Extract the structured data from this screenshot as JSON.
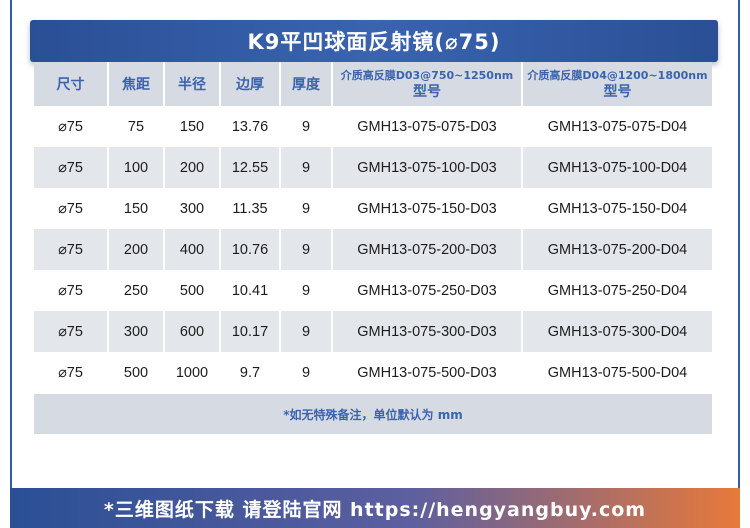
{
  "title": "K9平凹球面反射镜(⌀75)",
  "headers": {
    "size": "尺寸",
    "focal": "焦距",
    "radius": "半径",
    "edge": "边厚",
    "thickness": "厚度",
    "d03_line1": "介质高反膜D03@750~1250nm",
    "d03_line2": "型号",
    "d04_line1": "介质高反膜D04@1200~1800nm",
    "d04_line2": "型号"
  },
  "rows": [
    {
      "size": "⌀75",
      "focal": "75",
      "radius": "150",
      "edge": "13.76",
      "thickness": "9",
      "d03": "GMH13-075-075-D03",
      "d04": "GMH13-075-075-D04"
    },
    {
      "size": "⌀75",
      "focal": "100",
      "radius": "200",
      "edge": "12.55",
      "thickness": "9",
      "d03": "GMH13-075-100-D03",
      "d04": "GMH13-075-100-D04"
    },
    {
      "size": "⌀75",
      "focal": "150",
      "radius": "300",
      "edge": "11.35",
      "thickness": "9",
      "d03": "GMH13-075-150-D03",
      "d04": "GMH13-075-150-D04"
    },
    {
      "size": "⌀75",
      "focal": "200",
      "radius": "400",
      "edge": "10.76",
      "thickness": "9",
      "d03": "GMH13-075-200-D03",
      "d04": "GMH13-075-200-D04"
    },
    {
      "size": "⌀75",
      "focal": "250",
      "radius": "500",
      "edge": "10.41",
      "thickness": "9",
      "d03": "GMH13-075-250-D03",
      "d04": "GMH13-075-250-D04"
    },
    {
      "size": "⌀75",
      "focal": "300",
      "radius": "600",
      "edge": "10.17",
      "thickness": "9",
      "d03": "GMH13-075-300-D03",
      "d04": "GMH13-075-300-D04"
    },
    {
      "size": "⌀75",
      "focal": "500",
      "radius": "1000",
      "edge": "9.7",
      "thickness": "9",
      "d03": "GMH13-075-500-D03",
      "d04": "GMH13-075-500-D04"
    }
  ],
  "note": "*如无特殊备注，单位默认为 mm",
  "footer": "*三维图纸下载 请登陆官网 https://hengyangbuy.com",
  "colors": {
    "brand_blue": "#3b63b0",
    "header_gray": "#d6dbe3",
    "stripe_gray": "#e3e6eb",
    "footer_orange": "#e8793a"
  }
}
